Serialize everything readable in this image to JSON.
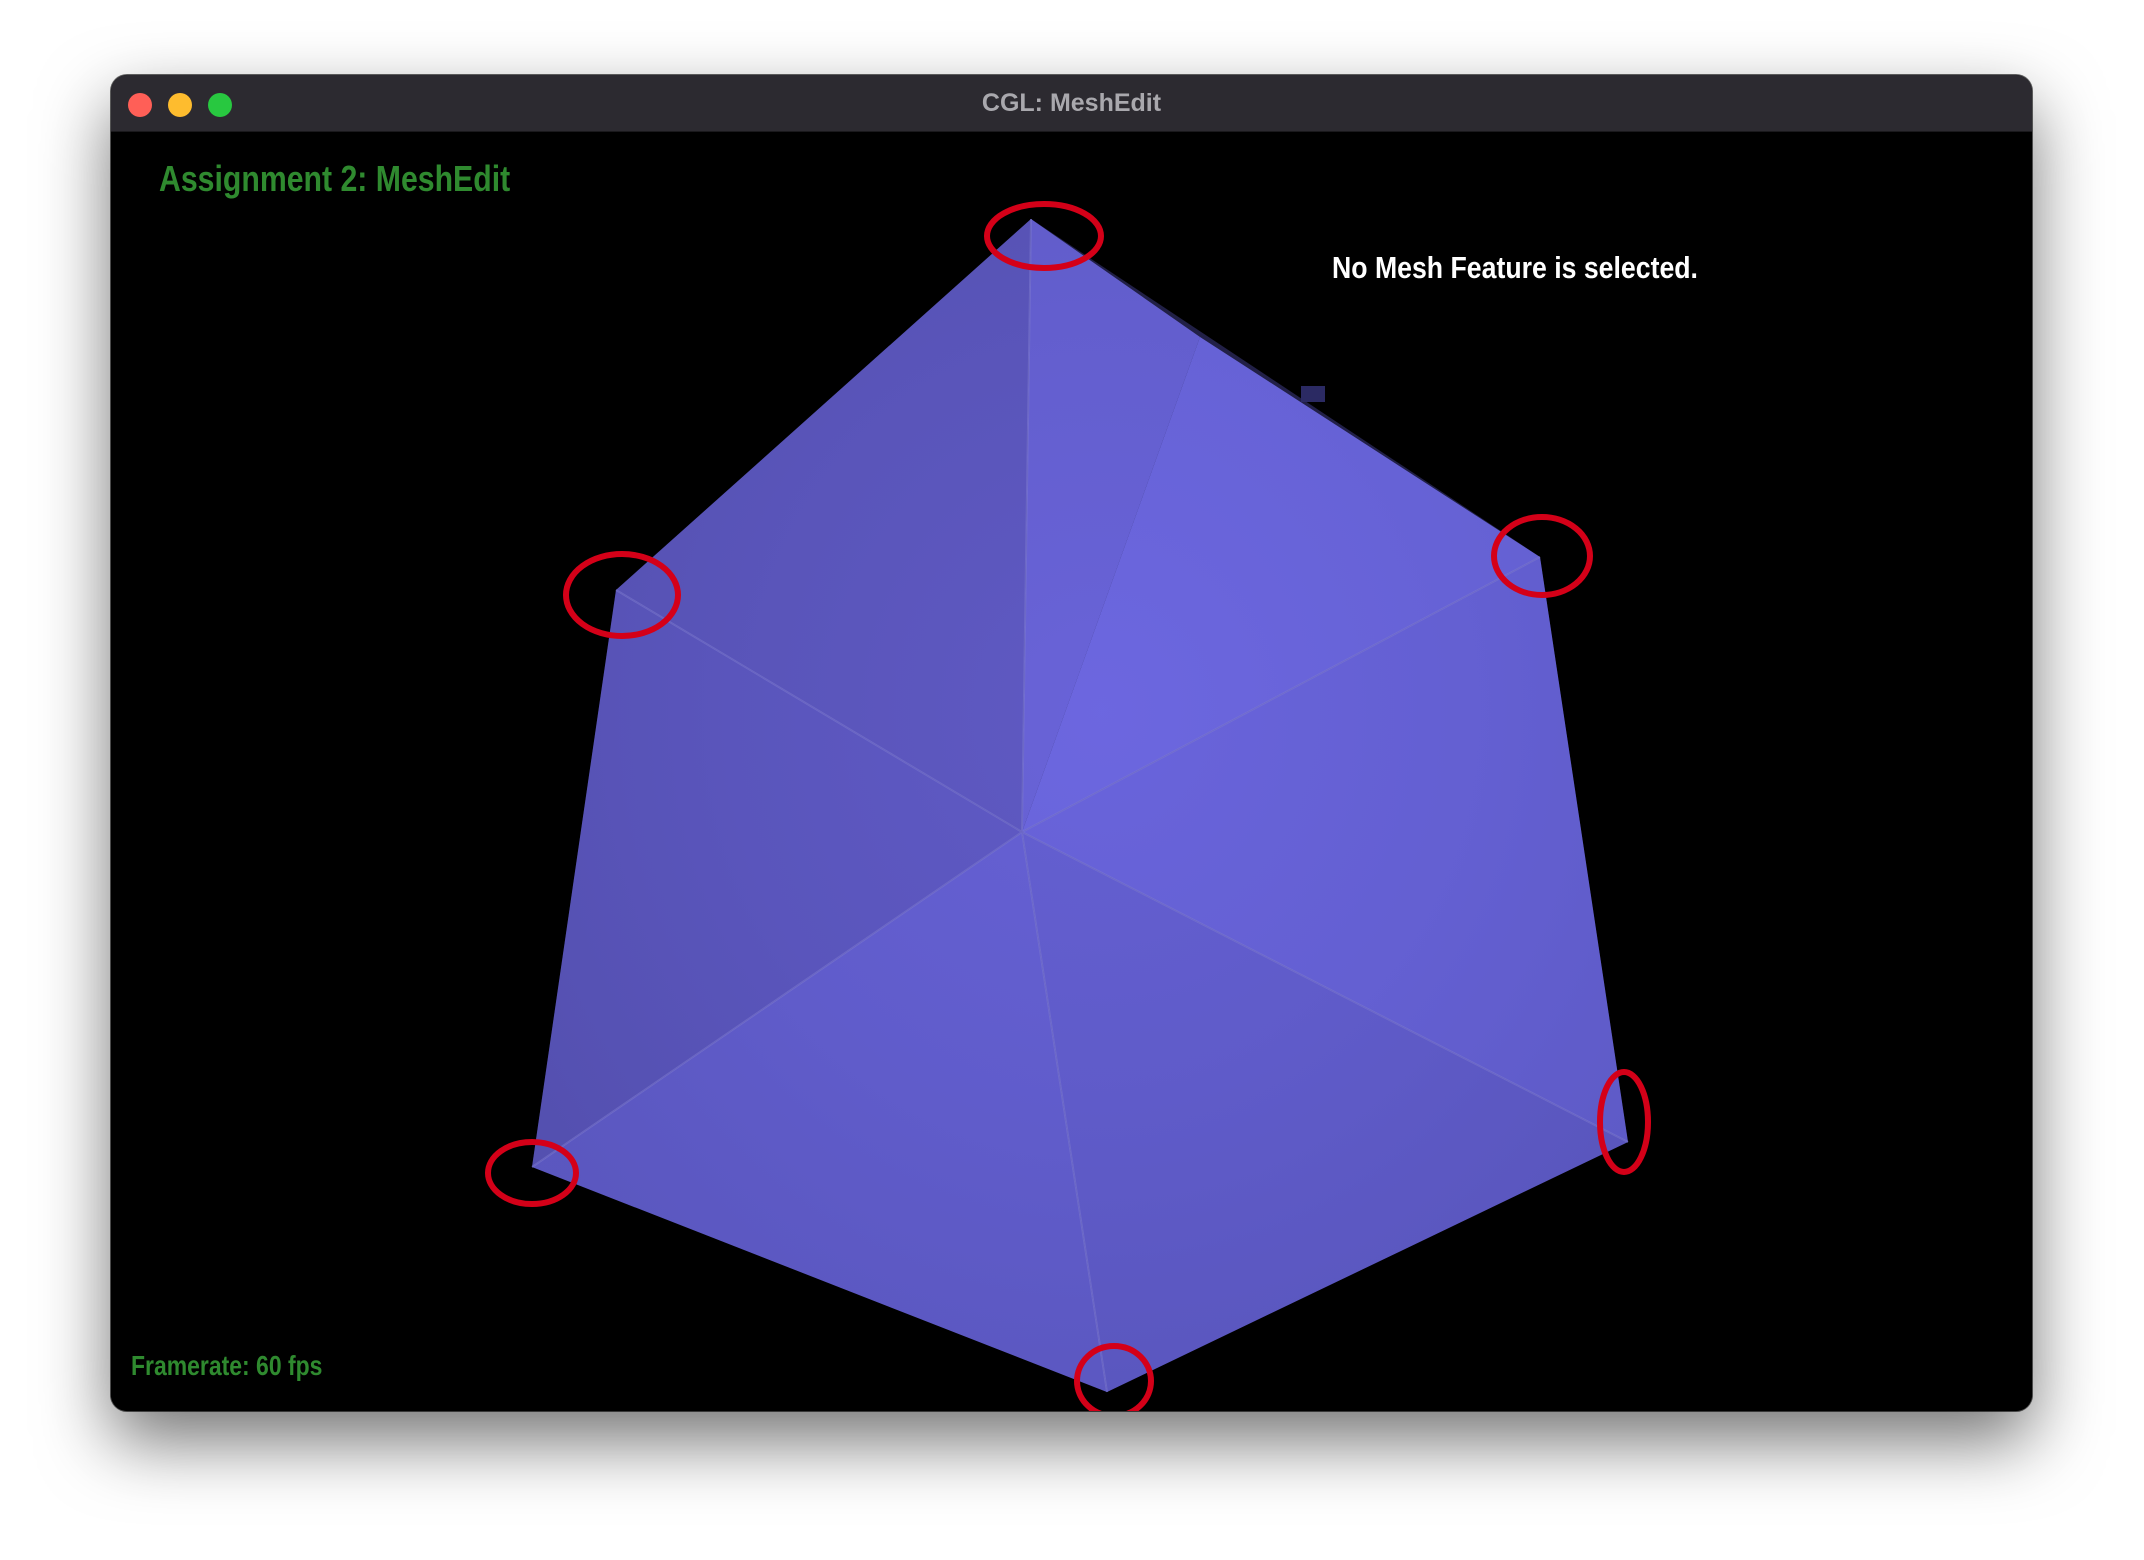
{
  "window": {
    "title": "CGL: MeshEdit",
    "traffic_lights": {
      "close": "#ff5f57",
      "minimize": "#febc2e",
      "maximize": "#28c840"
    }
  },
  "hud": {
    "assignment_title": "Assignment 2: MeshEdit",
    "selection_status": "No Mesh Feature is selected.",
    "framerate": "Framerate: 60 fps"
  },
  "colors": {
    "hud_green": "#2f8a2f",
    "hud_white": "#ffffff",
    "mesh_fill": "#6460d2",
    "annotation_red": "#d40018",
    "viewport_bg": "#000000"
  },
  "annotations": {
    "highlighted_vertex_count": 6
  }
}
